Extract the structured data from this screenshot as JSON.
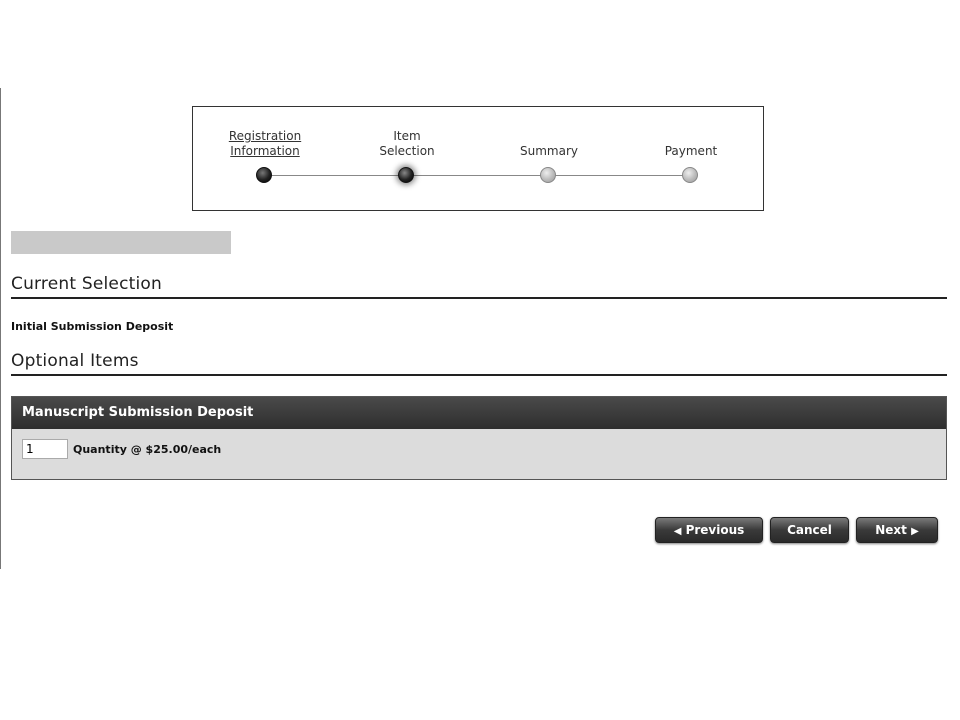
{
  "stepper": {
    "steps": [
      {
        "line1": "Registration",
        "line2": "Information",
        "state": "done"
      },
      {
        "line1": "Item",
        "line2": "Selection",
        "state": "current"
      },
      {
        "line1": "",
        "line2": "Summary",
        "state": "todo"
      },
      {
        "line1": "",
        "line2": "Payment",
        "state": "todo"
      }
    ]
  },
  "current_selection": {
    "title": "Current Selection",
    "item": "Initial Submission Deposit"
  },
  "optional_items": {
    "title": "Optional Items",
    "panel_title": "Manuscript Submission Deposit",
    "quantity_value": "1",
    "quantity_label": "Quantity @ $25.00/each"
  },
  "buttons": {
    "previous": "Previous",
    "previous_icon": "◀",
    "cancel": "Cancel",
    "next": "Next",
    "next_icon": "▶"
  }
}
